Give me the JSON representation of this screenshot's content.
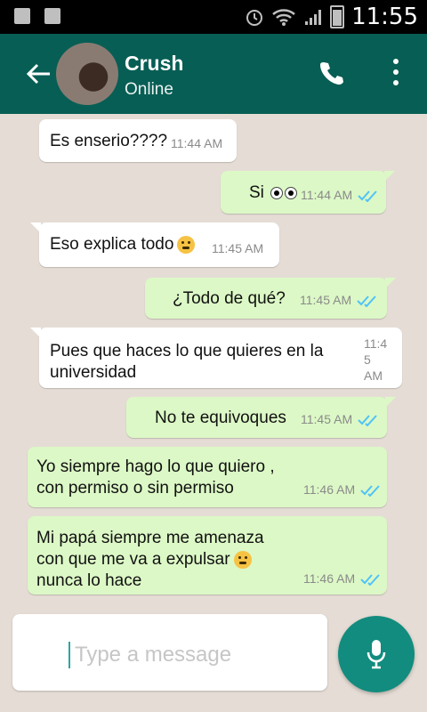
{
  "status_bar": {
    "time": "11:55"
  },
  "header": {
    "name": "Crush",
    "status": "Online"
  },
  "messages": [
    {
      "dir": "in",
      "text": "Es enserio????",
      "time": "11:44 AM"
    },
    {
      "dir": "out",
      "text": "Si",
      "time": "11:44 AM"
    },
    {
      "dir": "in",
      "text": "Eso explica todo",
      "time": "11:45 AM"
    },
    {
      "dir": "out",
      "text": "¿Todo de qué?",
      "time": "11:45 AM"
    },
    {
      "dir": "in",
      "text_line1": "Pues que haces lo que quieres en la",
      "text_line2": "universidad",
      "time_a": "11:4",
      "time_b": "5",
      "time_c": "AM"
    },
    {
      "dir": "out",
      "text": "No te equivoques",
      "time": "11:45 AM"
    },
    {
      "dir": "out",
      "text_line1": "Yo siempre hago lo que quiero ,",
      "text_line2": "con permiso o sin permiso",
      "time": "11:46 AM"
    },
    {
      "dir": "out",
      "text_line1": "Mi papá siempre me amenaza",
      "text_line2": "con que me va a expulsar",
      "text_line3": "nunca lo hace",
      "time": "11:46 AM"
    }
  ],
  "composer": {
    "placeholder": "Type a message"
  },
  "colors": {
    "header": "#075e54",
    "outgoing": "#dcf8c6",
    "incoming": "#ffffff",
    "mic": "#128c7e"
  },
  "icons": {
    "back": "arrow-back-icon",
    "call": "phone-icon",
    "menu": "more-vert-icon",
    "mic": "microphone-icon",
    "tick": "double-check-icon"
  }
}
